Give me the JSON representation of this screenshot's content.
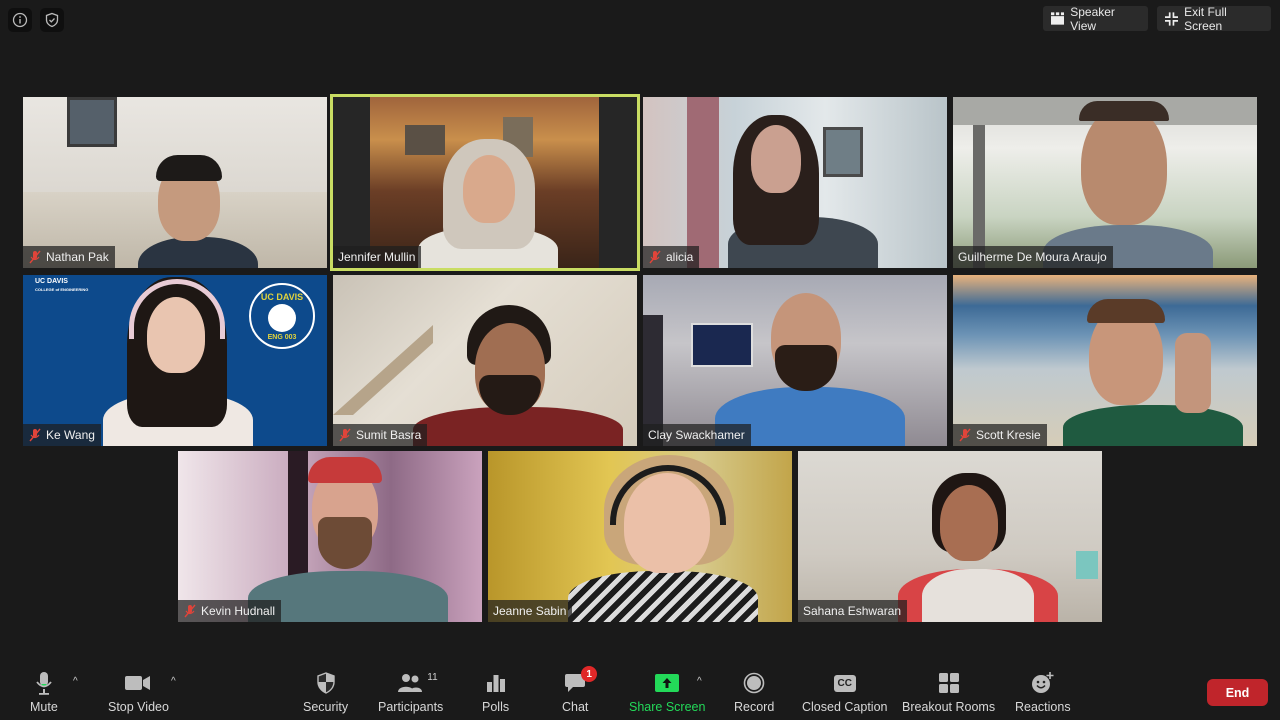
{
  "topbar": {
    "info_icon": "info-icon",
    "security_icon": "shield-check-icon",
    "speaker_view_label": "Speaker View",
    "exit_fullscreen_label": "Exit Full Screen"
  },
  "participants": [
    {
      "name": "Nathan Pak",
      "muted": true,
      "active": false
    },
    {
      "name": "Jennifer Mullin",
      "muted": false,
      "active": true
    },
    {
      "name": "alicia",
      "muted": true,
      "active": false
    },
    {
      "name": "Guilherme De Moura Araujo",
      "muted": false,
      "active": false
    },
    {
      "name": "Ke Wang",
      "muted": true,
      "active": false,
      "background_text": [
        "UC DAVIS",
        "COLLEGE of ENGINEERING",
        "UC DAVIS",
        "ENG 003"
      ]
    },
    {
      "name": "Sumit Basra",
      "muted": true,
      "active": false
    },
    {
      "name": "Clay Swackhamer",
      "muted": false,
      "active": false
    },
    {
      "name": "Scott Kresie",
      "muted": true,
      "active": false
    },
    {
      "name": "Kevin Hudnall",
      "muted": true,
      "active": false
    },
    {
      "name": "Jeanne Sabin",
      "muted": false,
      "active": false
    },
    {
      "name": "Sahana Eshwaran",
      "muted": false,
      "active": false
    }
  ],
  "toolbar": {
    "mute_label": "Mute",
    "stop_video_label": "Stop Video",
    "security_label": "Security",
    "participants_label": "Participants",
    "participants_count": "11",
    "polls_label": "Polls",
    "chat_label": "Chat",
    "chat_badge": "1",
    "share_screen_label": "Share Screen",
    "record_label": "Record",
    "closed_caption_label": "Closed Caption",
    "cc_glyph": "CC",
    "breakout_rooms_label": "Breakout Rooms",
    "reactions_label": "Reactions",
    "end_label": "End"
  },
  "colors": {
    "active_speaker_border": "#c9dd63",
    "share_green": "#23d959",
    "end_red": "#c0252b",
    "muted_red": "#e0443a",
    "badge_red": "#e02828"
  }
}
